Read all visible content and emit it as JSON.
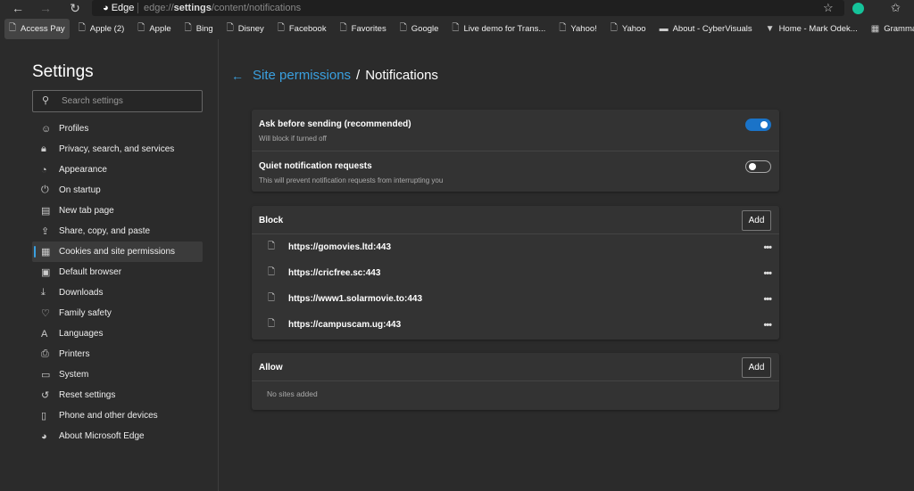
{
  "browser": {
    "brand": "Edge",
    "url_prefix": "edge://",
    "url_bold": "settings",
    "url_rest": "/content/notifications"
  },
  "bookmarks": [
    {
      "label": "Access Pay",
      "icon": "page-icon"
    },
    {
      "label": "Apple (2)",
      "icon": "page-icon"
    },
    {
      "label": "Apple",
      "icon": "page-icon"
    },
    {
      "label": "Bing",
      "icon": "page-icon"
    },
    {
      "label": "Disney",
      "icon": "page-icon"
    },
    {
      "label": "Facebook",
      "icon": "page-icon"
    },
    {
      "label": "Favorites",
      "icon": "page-icon"
    },
    {
      "label": "Google",
      "icon": "page-icon"
    },
    {
      "label": "Live demo for Trans...",
      "icon": "page-icon"
    },
    {
      "label": "Yahoo!",
      "icon": "page-icon"
    },
    {
      "label": "Yahoo",
      "icon": "page-icon"
    },
    {
      "label": "About - CyberVisuals",
      "icon": "cv-icon"
    },
    {
      "label": "Home - Mark Odek...",
      "icon": "site-icon"
    },
    {
      "label": "Grammarly for Micr...",
      "icon": "microsoft-icon"
    }
  ],
  "sidebar": {
    "title": "Settings",
    "search_placeholder": "Search settings",
    "items": [
      {
        "label": "Profiles",
        "icon": "profile-icon"
      },
      {
        "label": "Privacy, search, and services",
        "icon": "lock-icon"
      },
      {
        "label": "Appearance",
        "icon": "palette-icon"
      },
      {
        "label": "On startup",
        "icon": "power-icon"
      },
      {
        "label": "New tab page",
        "icon": "newtab-icon"
      },
      {
        "label": "Share, copy, and paste",
        "icon": "share-icon"
      },
      {
        "label": "Cookies and site permissions",
        "icon": "cookies-icon",
        "active": true
      },
      {
        "label": "Default browser",
        "icon": "browser-icon"
      },
      {
        "label": "Downloads",
        "icon": "download-icon"
      },
      {
        "label": "Family safety",
        "icon": "family-icon"
      },
      {
        "label": "Languages",
        "icon": "language-icon"
      },
      {
        "label": "Printers",
        "icon": "printer-icon"
      },
      {
        "label": "System",
        "icon": "laptop-icon"
      },
      {
        "label": "Reset settings",
        "icon": "reset-icon"
      },
      {
        "label": "Phone and other devices",
        "icon": "phone-icon"
      },
      {
        "label": "About Microsoft Edge",
        "icon": "edge-icon"
      }
    ]
  },
  "main": {
    "breadcrumb_link": "Site permissions",
    "breadcrumb_sep": "/",
    "breadcrumb_current": "Notifications",
    "toggles": [
      {
        "title": "Ask before sending (recommended)",
        "subtitle": "Will block if turned off",
        "on": true
      },
      {
        "title": "Quiet notification requests",
        "subtitle": "This will prevent notification requests from interrupting you",
        "on": false
      }
    ],
    "block": {
      "title": "Block",
      "add_label": "Add",
      "sites": [
        "https://gomovies.ltd:443",
        "https://cricfree.sc:443",
        "https://www1.solarmovie.to:443",
        "https://campuscam.ug:443"
      ]
    },
    "allow": {
      "title": "Allow",
      "add_label": "Add",
      "empty": "No sites added"
    }
  },
  "colors": {
    "accent": "#3aa0e0",
    "toggle_on": "#1a73c8"
  }
}
